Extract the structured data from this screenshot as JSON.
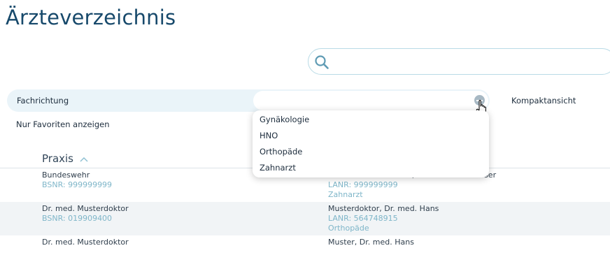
{
  "page": {
    "title": "Ärzteverzeichnis"
  },
  "search": {
    "value": "",
    "placeholder": ""
  },
  "filters": {
    "fachrichtung_label": "Fachrichtung",
    "fachrichtung_value": "",
    "kompakt_label": "Kompaktansicht",
    "favoriten_label": "Nur Favoriten anzeigen"
  },
  "dropdown": {
    "options": [
      "Gynäkologie",
      "HNO",
      "Orthopäde",
      "Zahnarzt"
    ]
  },
  "table": {
    "columns": {
      "praxis": "Praxis"
    },
    "rows": [
      {
        "praxis": "Bundeswehr",
        "bsnr": "BSNR: 999999999",
        "arzt": "von dem Bundeswehr, Dr. med. Oberweiser",
        "lanr": "LANR: 999999999",
        "fach": "Zahnarzt"
      },
      {
        "praxis": "Dr. med. Musterdoktor",
        "bsnr": "BSNR: 019909400",
        "arzt": "Musterdoktor, Dr. med. Hans",
        "lanr": "LANR: 564748915",
        "fach": "Orthopäde"
      },
      {
        "praxis": "Dr. med. Musterdoktor",
        "bsnr": "",
        "arzt": "Muster, Dr. med. Hans",
        "lanr": "",
        "fach": ""
      }
    ]
  },
  "colors": {
    "accent": "#17496b",
    "muted_text": "#7fb6c9",
    "filter_bg": "#eaf4f9",
    "search_border": "#b9dbe6"
  }
}
